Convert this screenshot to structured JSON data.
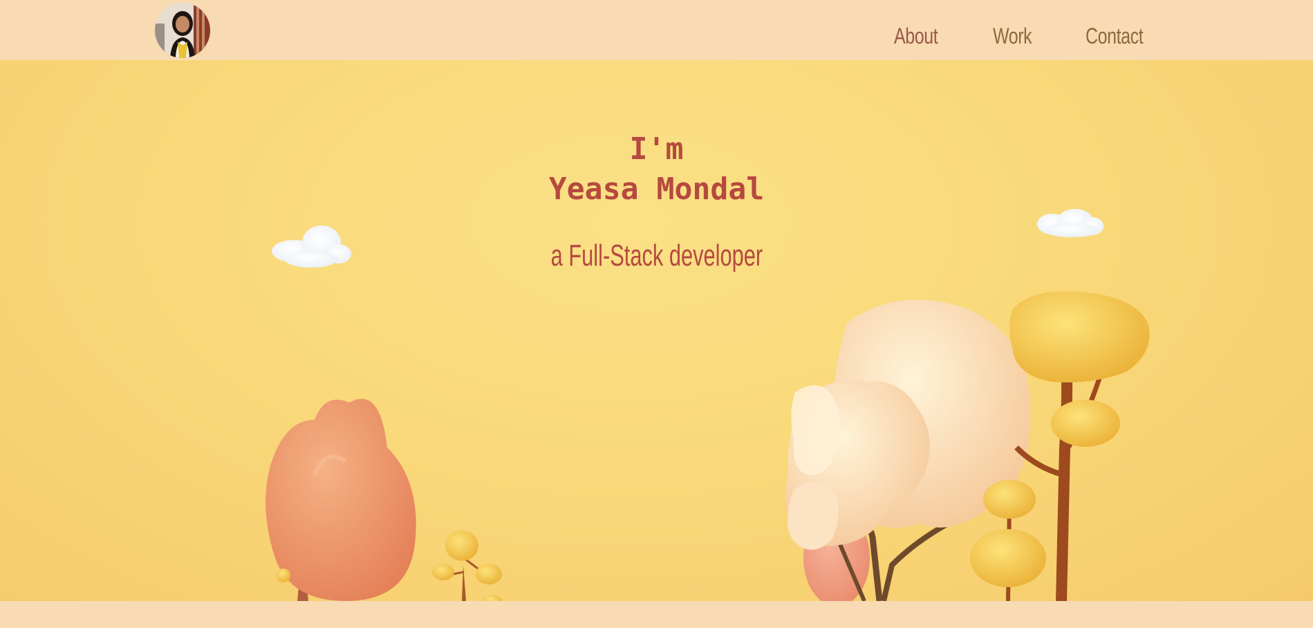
{
  "nav": {
    "items": [
      {
        "label": "About"
      },
      {
        "label": "Work"
      },
      {
        "label": "Contact"
      }
    ]
  },
  "hero": {
    "greeting": "I'm",
    "name": "Yeasa Mondal",
    "tagline": "a Full-Stack developer"
  },
  "colors": {
    "accent": "#b5493f",
    "navbar_bg": "#f8dab3",
    "hero_bg": "#f9d97a",
    "nav_text": "#8c6a3e"
  }
}
